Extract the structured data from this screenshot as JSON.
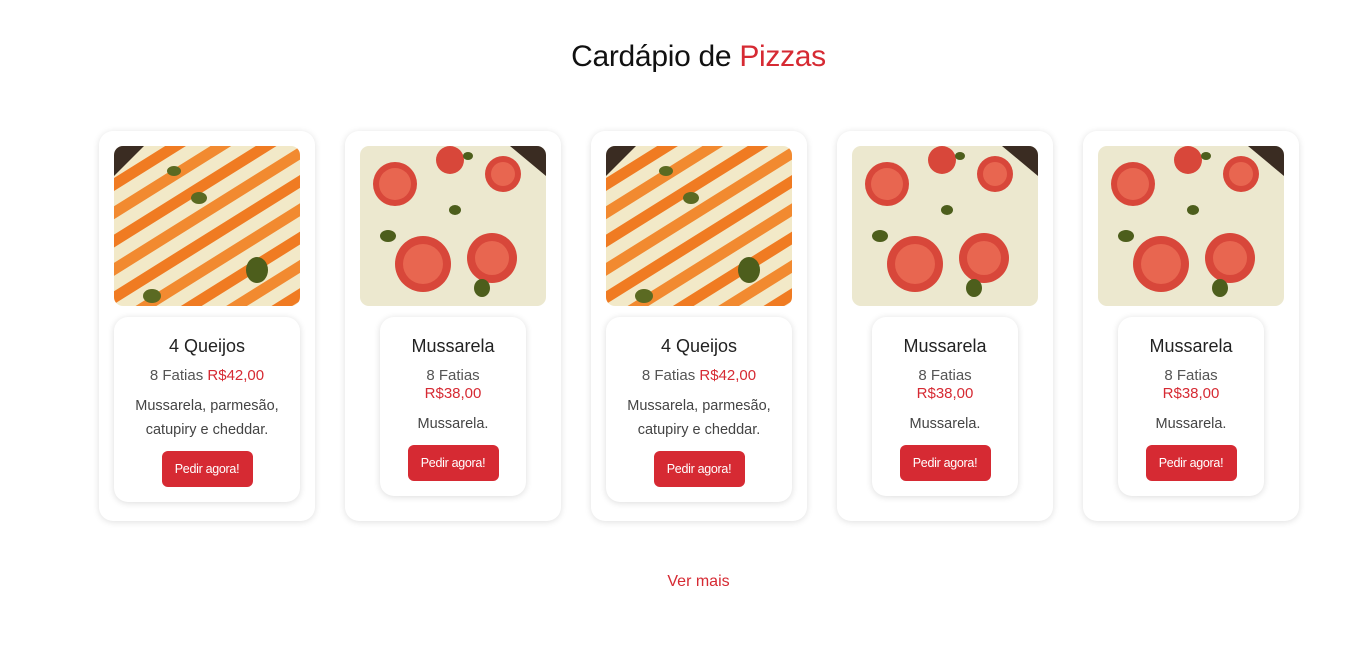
{
  "section": {
    "title_prefix": "Cardápio de",
    "title_accent": "Pizzas"
  },
  "pizzas": [
    {
      "name": "4 Queijos",
      "slices": "8 Fatias",
      "price": "R$42,00",
      "description": "Mussarela, parmesão, catupiry e cheddar.",
      "button": "Pedir agora!",
      "image": "four-cheese-pizza"
    },
    {
      "name": "Mussarela",
      "slices": "8 Fatias",
      "price": "R$38,00",
      "description": "Mussarela.",
      "button": "Pedir agora!",
      "image": "mozzarella-pizza"
    },
    {
      "name": "4 Queijos",
      "slices": "8 Fatias",
      "price": "R$42,00",
      "description": "Mussarela, parmesão, catupiry e cheddar.",
      "button": "Pedir agora!",
      "image": "four-cheese-pizza"
    },
    {
      "name": "Mussarela",
      "slices": "8 Fatias",
      "price": "R$38,00",
      "description": "Mussarela.",
      "button": "Pedir agora!",
      "image": "mozzarella-pizza"
    },
    {
      "name": "Mussarela",
      "slices": "8 Fatias",
      "price": "R$38,00",
      "description": "Mussarela.",
      "button": "Pedir agora!",
      "image": "mozzarella-pizza"
    }
  ],
  "see_more": "Ver mais",
  "colors": {
    "accent": "#d62a33",
    "title": "#111111"
  }
}
